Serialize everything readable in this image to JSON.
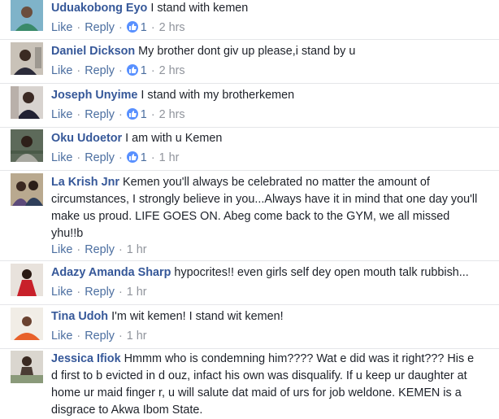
{
  "ui": {
    "like_label": "Like",
    "reply_label": "Reply",
    "separator": "·"
  },
  "comments": [
    {
      "author": "Uduakobong Eyo",
      "text": "I stand with kemen",
      "reactions": "1",
      "time": "2 hrs"
    },
    {
      "author": "Daniel Dickson",
      "text": "My brother dont giv up please,i stand by u",
      "reactions": "1",
      "time": "2 hrs"
    },
    {
      "author": "Joseph Unyime",
      "text": "I stand with my brotherkemen",
      "reactions": "1",
      "time": "2 hrs"
    },
    {
      "author": "Oku Udoetor",
      "text": "I am with u Kemen",
      "reactions": "1",
      "time": "1 hr"
    },
    {
      "author": "La Krish Jnr",
      "text": "Kemen you'll always be celebrated no matter the amount of circumstances, I strongly believe in you...Always have it in mind that one day you'll make us proud. LIFE GOES ON. Abeg come back to the GYM, we all missed yhu!!b",
      "time": "1 hr"
    },
    {
      "author": "Adazy Amanda Sharp",
      "text": "hypocrites!! even girls self dey open mouth talk rubbish...",
      "time": "1 hr"
    },
    {
      "author": "Tina Udoh",
      "text": "I'm wit kemen! I stand wit kemen!",
      "time": "1 hr"
    },
    {
      "author": "Jessica Ifiok",
      "text": "Hmmm who is condemning him???? Wat e did was it right??? His e d first to b evicted in d ouz, infact his own was disqualify. If u keep ur daughter at home ur maid finger r, u will salute dat maid of urs for job weldone. KEMEN is a disgrace to Akwa Ibom State."
    }
  ],
  "colors": {
    "name": "#365899",
    "link": "#4b6ea0",
    "meta": "#90949c",
    "like_badge": "#5890ff",
    "divider": "#e5e6e9"
  }
}
